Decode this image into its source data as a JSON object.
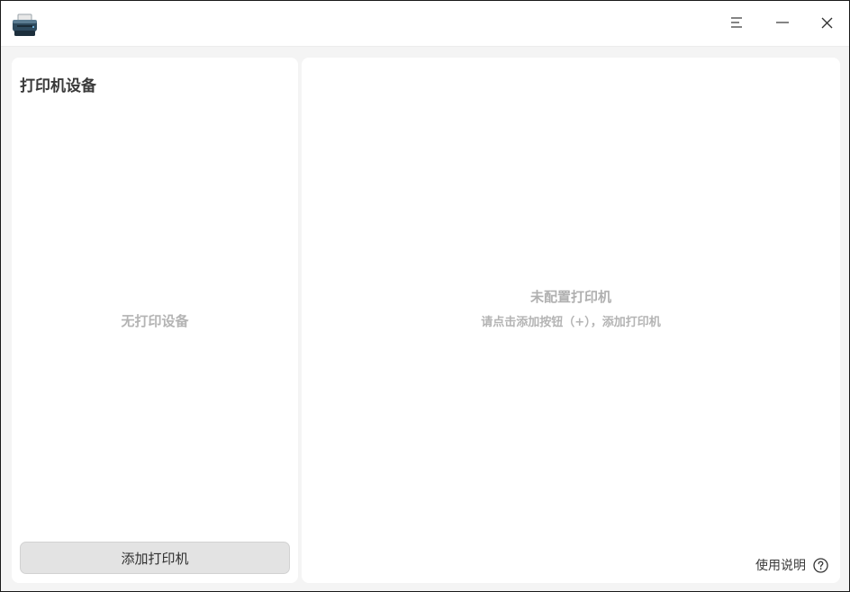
{
  "titlebar": {
    "app_icon": "printer-icon",
    "menu_icon": "menu-icon",
    "minimize_icon": "minimize-icon",
    "close_icon": "close-icon"
  },
  "sidebar": {
    "title": "打印机设备",
    "empty_text": "无打印设备",
    "add_button_label": "添加打印机"
  },
  "main": {
    "title": "未配置打印机",
    "subtitle": "请点击添加按钮（+），添加打印机",
    "help_label": "使用说明",
    "help_icon": "help-icon"
  }
}
